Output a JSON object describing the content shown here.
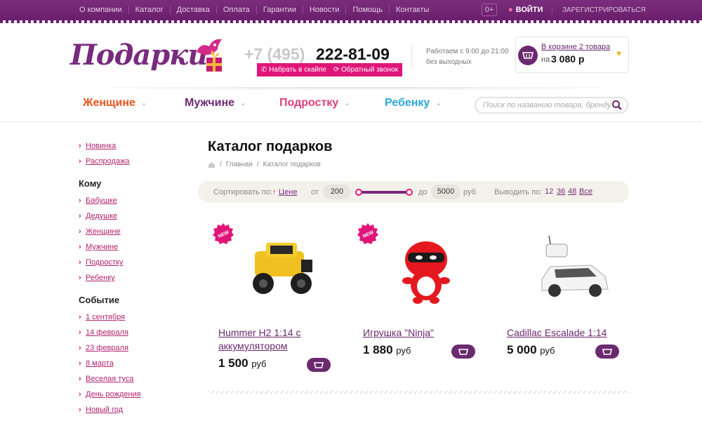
{
  "topnav": [
    "О компании",
    "Каталог",
    "Доставка",
    "Оплата",
    "Гарантии",
    "Новости",
    "Помощь",
    "Контакты"
  ],
  "age": "0+",
  "login": "ВОЙТИ",
  "register": "ЗАРЕГИСТРИРОВАТЬСЯ",
  "logo": "Подарки",
  "phone": {
    "code": "+7 (495)",
    "number": "222-81-09",
    "skype": "Набрать в скайпе",
    "callback": "Обратный звонок"
  },
  "hours": {
    "line1": "Работаем с 9:00 до 21:00",
    "line2": "без выходных"
  },
  "cart": {
    "count": "В корзине 2 товара",
    "sum_label": "на",
    "sum": "3 080 р"
  },
  "categories": [
    {
      "label": "Женщине",
      "color": "#e8541c"
    },
    {
      "label": "Мужчине",
      "color": "#6b2a6f"
    },
    {
      "label": "Подростку",
      "color": "#e0407a"
    },
    {
      "label": "Ребенку",
      "color": "#2aa8d8"
    }
  ],
  "search": {
    "placeholder": "Поиск по названию товара, бренду..."
  },
  "sidebar": {
    "top": [
      "Новинка",
      "Распродажа"
    ],
    "whom_title": "Кому",
    "whom": [
      "Бабушке",
      "Дедушке",
      "Женщине",
      "Мужчине",
      "Подростку",
      "Ребенку"
    ],
    "event_title": "Событие",
    "events": [
      "1 сентября",
      "14 февраля",
      "23 февраля",
      "8 марта",
      "Веселая туса",
      "День рождения",
      "Новый год"
    ]
  },
  "main": {
    "title": "Каталог подарков",
    "crumbs": [
      "Главная",
      "Каталог подарков"
    ]
  },
  "sort": {
    "label": "Сортировать по:",
    "by": "Цене",
    "from": "от",
    "min": "200",
    "to": "до",
    "max": "5000",
    "currency": "руб",
    "show": "Выводить по:",
    "per_page": [
      "12",
      "36",
      "48",
      "Все"
    ]
  },
  "products": [
    {
      "name": "Hummer H2 1:14 с аккумулятором",
      "price": "1 500",
      "currency": "руб",
      "badge": "NEW"
    },
    {
      "name": "Игрушка \"Ninja\"",
      "price": "1 880",
      "currency": "руб",
      "badge": "NEW"
    },
    {
      "name": "Cadillac Escalade 1:14",
      "price": "5 000",
      "currency": "руб",
      "badge": ""
    }
  ]
}
